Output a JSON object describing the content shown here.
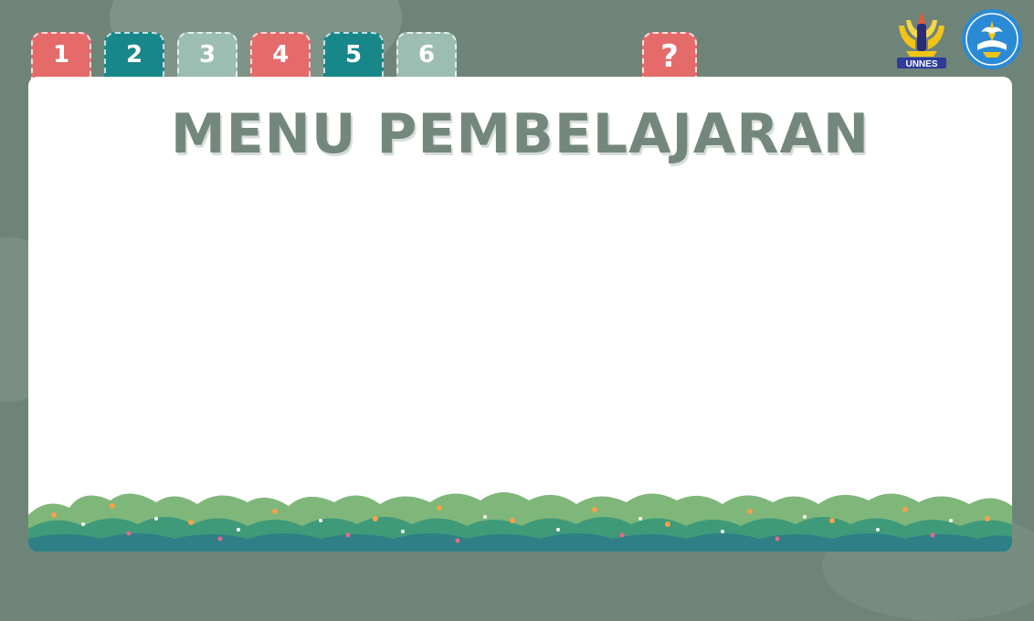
{
  "tabs": [
    {
      "label": "1",
      "color": "#e46b6a"
    },
    {
      "label": "2",
      "color": "#18878a"
    },
    {
      "label": "3",
      "color": "#9cbdb1"
    },
    {
      "label": "4",
      "color": "#e46b6a"
    },
    {
      "label": "5",
      "color": "#18878a"
    },
    {
      "label": "6",
      "color": "#9cbdb1"
    }
  ],
  "help": {
    "label": "?"
  },
  "logos": {
    "unnes_text": "UNNES"
  },
  "main": {
    "title": "MENU PEMBELAJARAN"
  },
  "colors": {
    "background": "#6f8479",
    "board": "#ffffff",
    "title": "#74877c",
    "red": "#e46b6a",
    "teal": "#18878a",
    "sage": "#9cbdb1"
  }
}
